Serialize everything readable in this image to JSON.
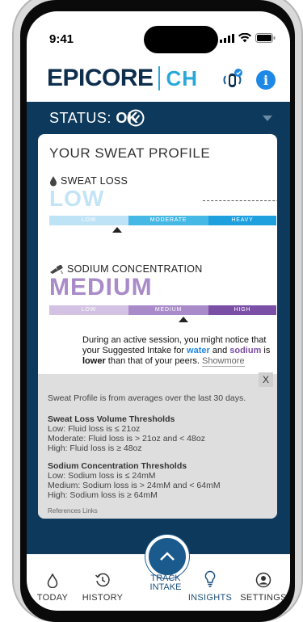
{
  "status_bar": {
    "time": "9:41"
  },
  "header": {
    "logo_main": "EPICORE",
    "logo_sub": "CH"
  },
  "status": {
    "label": "STATUS:",
    "value": "OK"
  },
  "profile": {
    "title": "YOUR SWEAT PROFILE",
    "sweat_loss": {
      "label": "SWEAT LOSS",
      "level": "LOW",
      "segments": [
        "LOW",
        "MODERATE",
        "HEAVY"
      ],
      "colors": [
        "#bfe3f6",
        "#45b8e6",
        "#1e9fde"
      ],
      "marker_fraction": 0.3
    },
    "sodium": {
      "label": "SODIUM CONCENTRATION",
      "level": "MEDIUM",
      "segments": [
        "LOW",
        "MEDIUM",
        "HIGH"
      ],
      "colors": [
        "#d3c2e3",
        "#a98bc9",
        "#7b4fa5"
      ],
      "marker_fraction": 0.59
    },
    "note": {
      "text1": "During an active session, you might notice that your Suggested Intake for ",
      "water": "water",
      "and": " and ",
      "sodium": "sodium",
      "is": " is ",
      "lower": "lower",
      "text2": " than that of your peers. ",
      "show_more": "Showmore"
    }
  },
  "info": {
    "close": "X",
    "intro": "Sweat Profile is from averages over the last 30 days.",
    "sweat_heading": "Sweat Loss Volume Thresholds",
    "sweat_lines": [
      "Low: Fluid loss is ≤ 21oz",
      "Moderate: Fluid loss is > 21oz and < 48oz",
      "High: Fluid loss is ≥ 48oz"
    ],
    "sodium_heading": "Sodium Concentration Thresholds",
    "sodium_lines": [
      "Low: Sodium loss is ≤ 24mM",
      "Medium: Sodium loss is > 24mM and < 64mM",
      "High: Sodium loss is ≥ 64mM"
    ],
    "references": "References Links"
  },
  "nav": {
    "today": "TODAY",
    "history": "HISTORY",
    "track_1": "TRACK",
    "track_2": "INTAKE",
    "insights": "INSIGHTS",
    "settings": "SETTINGS"
  }
}
